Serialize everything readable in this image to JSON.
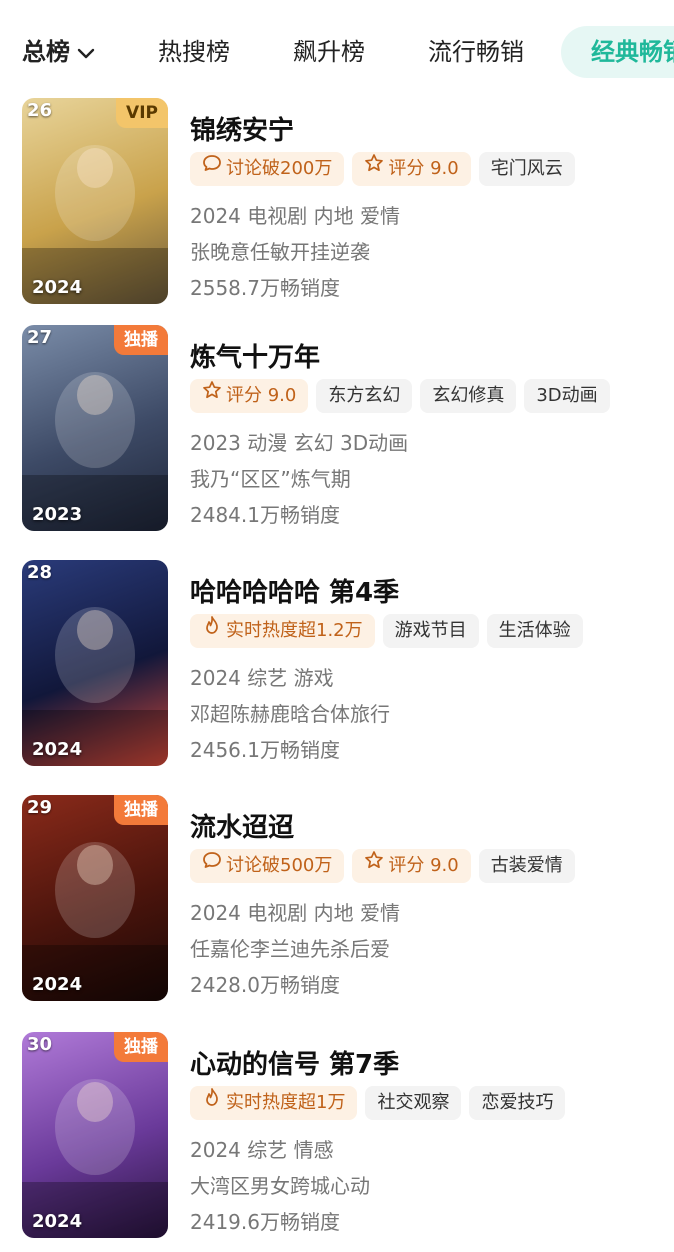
{
  "tabs": {
    "first": "总榜",
    "items": [
      "热搜榜",
      "飙升榜",
      "流行畅销"
    ],
    "active": "经典畅销"
  },
  "items": [
    {
      "rank": "26",
      "badge": "VIP",
      "year": "2024",
      "title": "锦绣安宁",
      "tags": [
        {
          "icon": "chat-icon",
          "text": "讨论破200万",
          "style": "hot"
        },
        {
          "icon": "star-icon",
          "text": "评分 9.0",
          "style": "hot"
        },
        {
          "icon": "",
          "text": "宅门风云",
          "style": "plain"
        }
      ],
      "info": "2024 电视剧 内地 爱情",
      "desc": "张晚意任敏开挂逆袭",
      "sales": "2558.7万畅销度",
      "colors": [
        "#e8d49a",
        "#c9a24b",
        "#6b5a3a"
      ]
    },
    {
      "rank": "27",
      "badge": "独播",
      "year": "2023",
      "title": "炼气十万年",
      "tags": [
        {
          "icon": "star-icon",
          "text": "评分 9.0",
          "style": "hot"
        },
        {
          "icon": "",
          "text": "东方玄幻",
          "style": "plain"
        },
        {
          "icon": "",
          "text": "玄幻修真",
          "style": "plain"
        },
        {
          "icon": "",
          "text": "3D动画",
          "style": "plain"
        }
      ],
      "info": "2023 动漫 玄幻 3D动画",
      "desc": "我乃“区区”炼气期",
      "sales": "2484.1万畅销度",
      "colors": [
        "#7a8ca8",
        "#3d4a66",
        "#1e2538"
      ]
    },
    {
      "rank": "28",
      "badge": "",
      "year": "2024",
      "title": "哈哈哈哈哈 第4季",
      "tags": [
        {
          "icon": "fire-icon",
          "text": "实时热度超1.2万",
          "style": "hot"
        },
        {
          "icon": "",
          "text": "游戏节目",
          "style": "plain"
        },
        {
          "icon": "",
          "text": "生活体验",
          "style": "plain"
        }
      ],
      "info": "2024 综艺 游戏",
      "desc": "邓超陈赫鹿晗合体旅行",
      "sales": "2456.1万畅销度",
      "colors": [
        "#2a3b7a",
        "#11173a",
        "#d64a3a"
      ]
    },
    {
      "rank": "29",
      "badge": "独播",
      "year": "2024",
      "title": "流水迢迢",
      "tags": [
        {
          "icon": "chat-icon",
          "text": "讨论破500万",
          "style": "hot"
        },
        {
          "icon": "star-icon",
          "text": "评分 9.0",
          "style": "hot"
        },
        {
          "icon": "",
          "text": "古装爱情",
          "style": "plain"
        }
      ],
      "info": "2024 电视剧 内地 爱情",
      "desc": "任嘉伦李兰迪先杀后爱",
      "sales": "2428.0万畅销度",
      "colors": [
        "#8a2a1a",
        "#4a140c",
        "#1a0806"
      ]
    },
    {
      "rank": "30",
      "badge": "独播",
      "year": "2024",
      "title": "心动的信号 第7季",
      "tags": [
        {
          "icon": "fire-icon",
          "text": "实时热度超1万",
          "style": "hot"
        },
        {
          "icon": "",
          "text": "社交观察",
          "style": "plain"
        },
        {
          "icon": "",
          "text": "恋爱技巧",
          "style": "plain"
        }
      ],
      "info": "2024 综艺 情感",
      "desc": "大湾区男女跨城心动",
      "sales": "2419.6万畅销度",
      "colors": [
        "#b07ad8",
        "#6a3a9a",
        "#2a1440"
      ]
    }
  ]
}
